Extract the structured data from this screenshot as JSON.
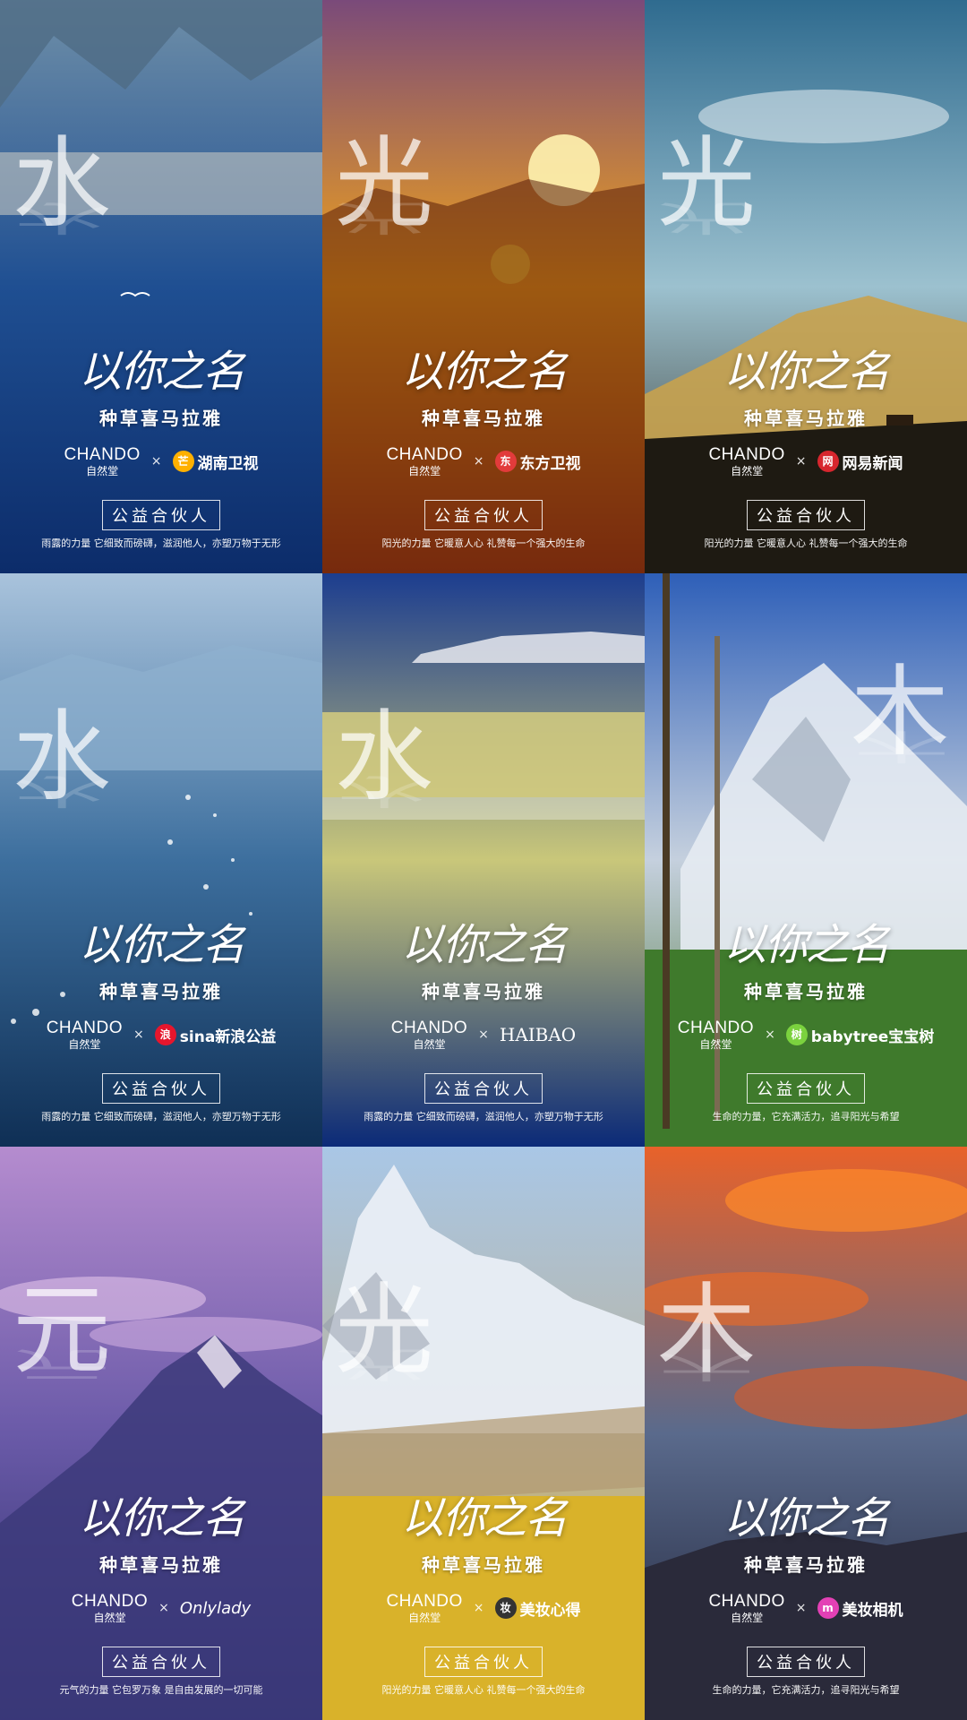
{
  "posters": [
    {
      "element": "水",
      "headline": "以你之名",
      "subtitle": "种草喜马拉雅",
      "brand_en": "CHANDO",
      "brand_cn": "自然堂",
      "times": "×",
      "partner": "湖南卫视",
      "partner_icon": "mango-logo-icon",
      "partner_color": "#ffb000",
      "partner_badge": "芒",
      "partner_box": "公益合伙人",
      "slogan": "雨露的力量 它细致而磅礴，滋润他人，亦塑万物于无形",
      "colors": [
        "#6f8fa8",
        "#1f4f92",
        "#0c2c6a"
      ]
    },
    {
      "element": "光",
      "headline": "以你之名",
      "subtitle": "种草喜马拉雅",
      "brand_en": "CHANDO",
      "brand_cn": "自然堂",
      "times": "×",
      "partner": "东方卫视",
      "partner_icon": "dragon-tv-logo-icon",
      "partner_color": "#e23b3b",
      "partner_badge": "东",
      "partner_box": "公益合伙人",
      "slogan": "阳光的力量 它暖意人心 礼赞每一个强大的生命",
      "colors": [
        "#7a4a7a",
        "#f0a21c",
        "#9b3a12"
      ]
    },
    {
      "element": "光",
      "headline": "以你之名",
      "subtitle": "种草喜马拉雅",
      "brand_en": "CHANDO",
      "brand_cn": "自然堂",
      "times": "×",
      "partner": "网易新闻",
      "partner_icon": "netease-logo-icon",
      "partner_color": "#d7262e",
      "partner_badge": "网",
      "partner_box": "公益合伙人",
      "slogan": "阳光的力量 它暖意人心 礼赞每一个强大的生命",
      "colors": [
        "#2f6b8f",
        "#9cc1cf",
        "#2a2417"
      ]
    },
    {
      "element": "水",
      "headline": "以你之名",
      "subtitle": "种草喜马拉雅",
      "brand_en": "CHANDO",
      "brand_cn": "自然堂",
      "times": "×",
      "partner": "sina新浪公益",
      "partner_icon": "sina-logo-icon",
      "partner_color": "#e6162d",
      "partner_badge": "浪",
      "partner_box": "公益合伙人",
      "slogan": "雨露的力量 它细致而磅礴，滋润他人，亦塑万物于无形",
      "colors": [
        "#a9c3dc",
        "#3d6f9e",
        "#0f2f55"
      ]
    },
    {
      "element": "水",
      "headline": "以你之名",
      "subtitle": "种草喜马拉雅",
      "brand_en": "CHANDO",
      "brand_cn": "自然堂",
      "times": "×",
      "partner": "HAIBAO",
      "partner_icon": "haibao-logo-icon",
      "partner_color": "#ffffff",
      "partner_badge": "",
      "partner_box": "公益合伙人",
      "slogan": "雨露的力量 它细致而磅礴，滋润他人，亦塑万物于无形",
      "colors": [
        "#1c3d8f",
        "#c9c77a",
        "#0b2a78"
      ]
    },
    {
      "element": "木",
      "headline": "以你之名",
      "subtitle": "种草喜马拉雅",
      "brand_en": "CHANDO",
      "brand_cn": "自然堂",
      "times": "×",
      "partner": "babytree宝宝树",
      "partner_icon": "babytree-logo-icon",
      "partner_color": "#7bd23e",
      "partner_badge": "树",
      "partner_box": "公益合伙人",
      "slogan": "生命的力量，它充满活力，追寻阳光与希望",
      "colors": [
        "#2e5fb8",
        "#c5d0de",
        "#3f6b25"
      ]
    },
    {
      "element": "元",
      "headline": "以你之名",
      "subtitle": "种草喜马拉雅",
      "brand_en": "CHANDO",
      "brand_cn": "自然堂",
      "times": "×",
      "partner": "Onlylady",
      "partner_icon": "onlylady-logo-icon",
      "partner_color": "#ffffff",
      "partner_badge": "",
      "partner_box": "公益合伙人",
      "slogan": "元气的力量 它包罗万象 是自由发展的一切可能",
      "colors": [
        "#b58ccf",
        "#6a5aa8",
        "#2b2d6b"
      ]
    },
    {
      "element": "光",
      "headline": "以你之名",
      "subtitle": "种草喜马拉雅",
      "brand_en": "CHANDO",
      "brand_cn": "自然堂",
      "times": "×",
      "partner": "美妆心得",
      "partner_icon": "meizhuang-logo-icon",
      "partner_color": "#333333",
      "partner_badge": "妆",
      "partner_box": "公益合伙人",
      "slogan": "阳光的力量 它暖意人心 礼赞每一个强大的生命",
      "colors": [
        "#a9c7e6",
        "#b9b3a0",
        "#d8b22a"
      ]
    },
    {
      "element": "木",
      "headline": "以你之名",
      "subtitle": "种草喜马拉雅",
      "brand_en": "CHANDO",
      "brand_cn": "自然堂",
      "times": "×",
      "partner": "美妆相机",
      "partner_icon": "meizhuang-camera-logo-icon",
      "partner_color": "#e340b5",
      "partner_badge": "m",
      "partner_box": "公益合伙人",
      "slogan": "生命的力量，它充满活力，追寻阳光与希望",
      "colors": [
        "#e8622a",
        "#5a6a8c",
        "#1c1f33"
      ]
    }
  ]
}
